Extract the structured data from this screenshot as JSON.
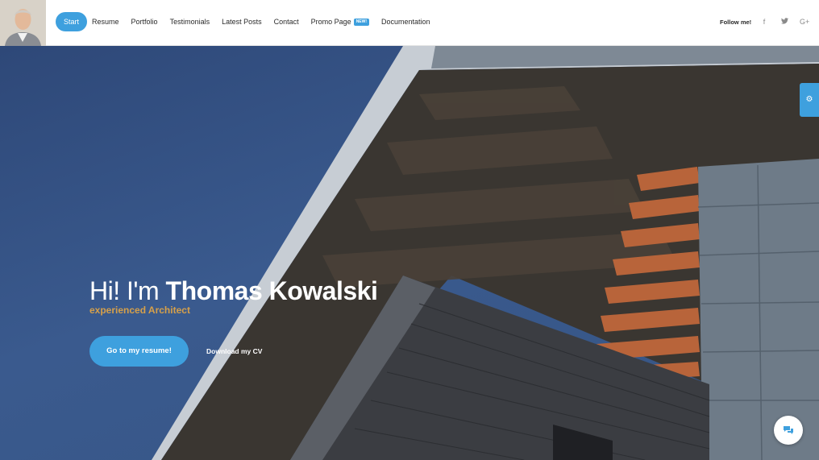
{
  "nav": {
    "items": [
      {
        "label": "Start",
        "active": true
      },
      {
        "label": "Resume"
      },
      {
        "label": "Portfolio"
      },
      {
        "label": "Testimonials"
      },
      {
        "label": "Latest Posts"
      },
      {
        "label": "Contact"
      },
      {
        "label": "Promo Page",
        "badge": "NEW!"
      },
      {
        "label": "Documentation"
      }
    ]
  },
  "header": {
    "follow_label": "Follow me!",
    "social_icons": [
      "facebook-icon",
      "twitter-icon",
      "google-plus-icon"
    ],
    "social_glyphs": [
      "f",
      "t",
      "G+"
    ]
  },
  "hero": {
    "greeting": "Hi! I'm",
    "name": "Thomas Kowalski",
    "tagline": "experienced Architect",
    "primary_button": "Go to my resume!",
    "secondary_button": "Download my CV"
  },
  "colors": {
    "accent": "#3ea0de",
    "tagline": "#d6a04a",
    "sky": "#33507f"
  }
}
